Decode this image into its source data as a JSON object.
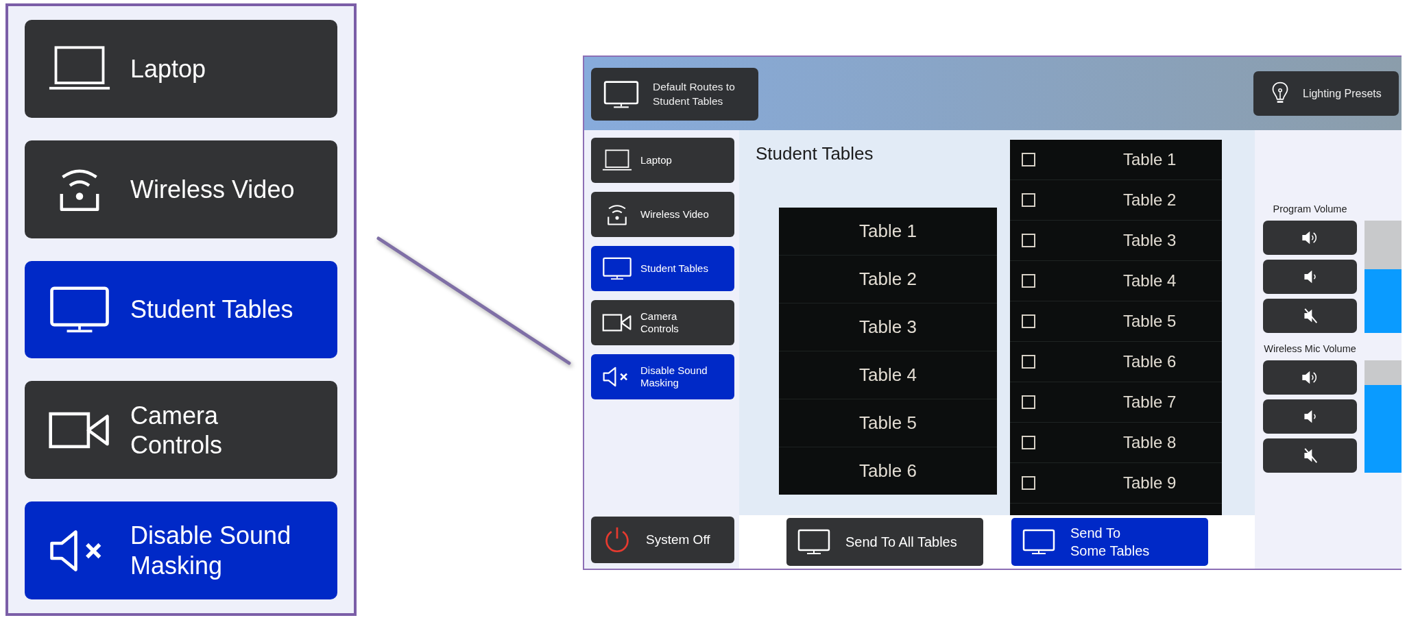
{
  "callout": {
    "items": [
      {
        "label": "Laptop",
        "kind": "laptop",
        "selected": false
      },
      {
        "label": "Wireless Video",
        "kind": "wireless",
        "selected": false
      },
      {
        "label": "Student Tables",
        "kind": "monitor",
        "selected": true
      },
      {
        "label": "Camera\nControls",
        "kind": "camera",
        "selected": false
      },
      {
        "label": "Disable Sound\nMasking",
        "kind": "speaker-x",
        "selected": true
      }
    ]
  },
  "screen": {
    "header": {
      "routes_button": {
        "label": "Default Routes to\nStudent Tables"
      },
      "lighting_button": {
        "label": "Lighting Presets"
      }
    },
    "sidebar": {
      "items": [
        {
          "label": "Laptop",
          "kind": "laptop",
          "selected": false
        },
        {
          "label": "Wireless Video",
          "kind": "wireless",
          "selected": false
        },
        {
          "label": "Student Tables",
          "kind": "monitor",
          "selected": true
        },
        {
          "label": "Camera\nControls",
          "kind": "camera",
          "selected": false
        },
        {
          "label": "Disable Sound\nMasking",
          "kind": "speaker-x",
          "selected": true
        }
      ],
      "power_button": {
        "label": "System Off"
      }
    },
    "title": "Student Tables",
    "table_list": [
      {
        "label": "Table 1"
      },
      {
        "label": "Table 2"
      },
      {
        "label": "Table 3"
      },
      {
        "label": "Table 4"
      },
      {
        "label": "Table 5"
      },
      {
        "label": "Table 6"
      }
    ],
    "checklist": [
      {
        "label": "Table 1",
        "checked": false
      },
      {
        "label": "Table 2",
        "checked": false
      },
      {
        "label": "Table 3",
        "checked": false
      },
      {
        "label": "Table 4",
        "checked": false
      },
      {
        "label": "Table 5",
        "checked": false
      },
      {
        "label": "Table 6",
        "checked": false
      },
      {
        "label": "Table 7",
        "checked": false
      },
      {
        "label": "Table 8",
        "checked": false
      },
      {
        "label": "Table 9",
        "checked": false
      }
    ],
    "actions": [
      {
        "label": "Send To All Tables",
        "selected": false
      },
      {
        "label": "Send To\nSome Tables",
        "selected": true
      }
    ],
    "volumes": [
      {
        "label": "Program Volume",
        "level": 0.57
      },
      {
        "label": "Wireless Mic Volume",
        "level": 0.78
      }
    ]
  }
}
